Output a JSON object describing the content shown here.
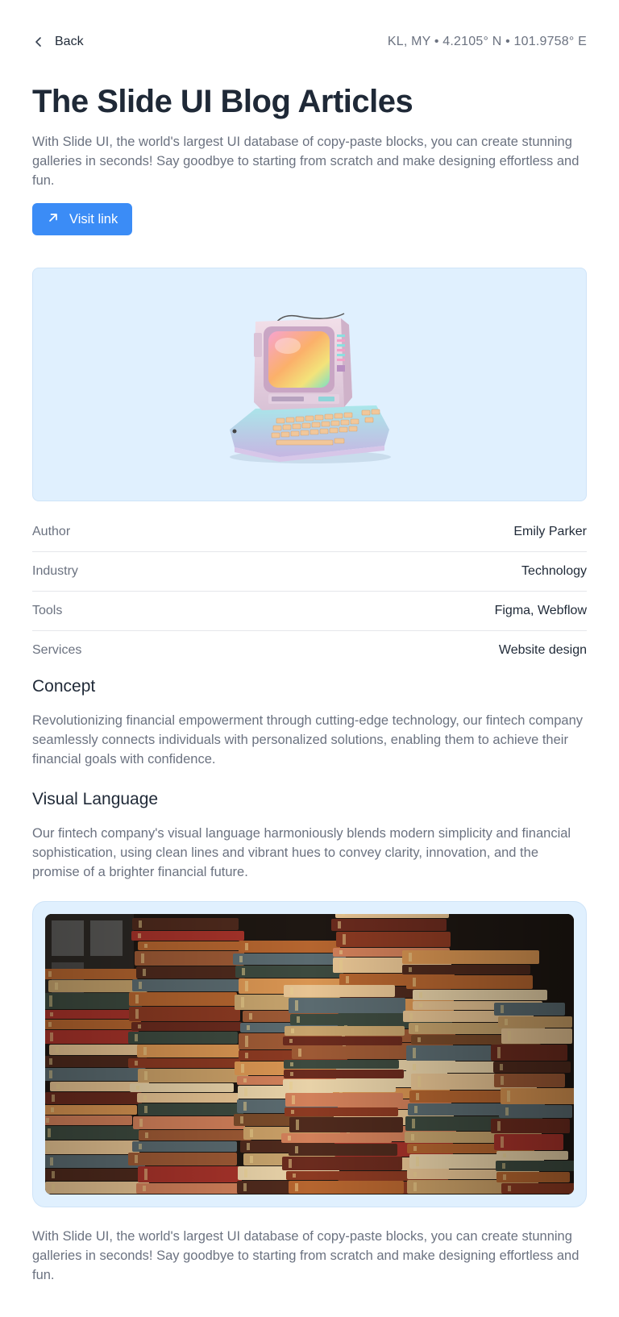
{
  "header": {
    "back_label": "Back",
    "location": "KL, MY • 4.2105° N • 101.9758° E"
  },
  "hero": {
    "title": "The Slide UI Blog Articles",
    "intro": "With Slide UI, the world's largest UI database of copy-paste blocks, you can create stunning galleries in seconds! Say goodbye to starting from scratch and make designing effortless and fun.",
    "visit_label": "Visit link"
  },
  "info": [
    {
      "label": "Author",
      "value": "Emily Parker"
    },
    {
      "label": "Industry",
      "value": "Technology"
    },
    {
      "label": "Tools",
      "value": "Figma, Webflow"
    },
    {
      "label": "Services",
      "value": "Website design"
    }
  ],
  "concept": {
    "title": "Concept",
    "text": "Revolutionizing financial empowerment through cutting-edge technology, our fintech company seamlessly connects individuals with personalized solutions, enabling them to achieve their financial goals with confidence."
  },
  "visual_language": {
    "title": "Visual Language",
    "text": "Our fintech company's visual language harmoniously blends modern simplicity and financial sophistication, using clean lines and vibrant hues to convey clarity, innovation, and the promise of a brighter financial future."
  },
  "footer_text": "With Slide UI, the world's largest UI database of copy-paste blocks, you can create stunning galleries in seconds! Say goodbye to starting from scratch and make designing effortless and fun.",
  "icons": {
    "back": "chevron-left-icon",
    "visit": "arrow-up-right-icon"
  },
  "colors": {
    "accent": "#3b8cf6",
    "panel": "#e0f0fe",
    "muted_text": "#6b7280",
    "text": "#1f2937"
  }
}
